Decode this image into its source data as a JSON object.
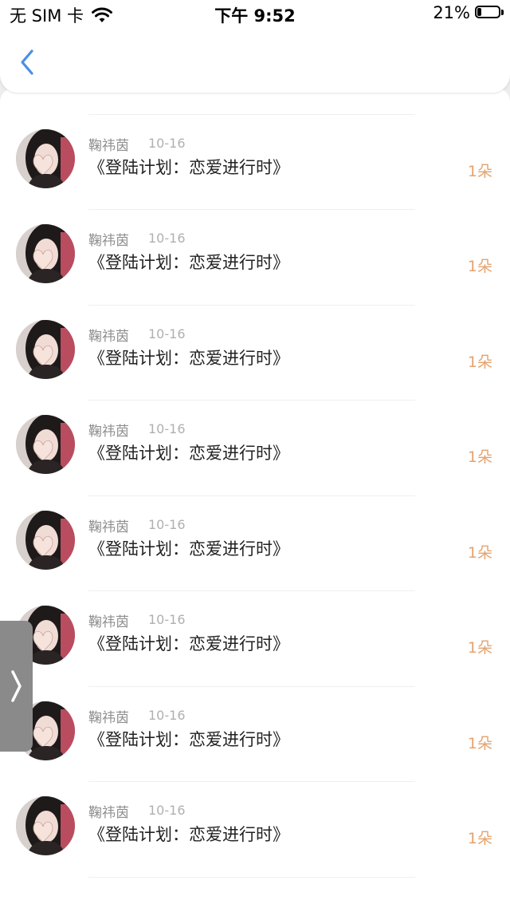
{
  "status_bar": {
    "carrier": "无 SIM 卡",
    "time": "下午 9:52",
    "battery": "21%",
    "battery_level": 0.21
  },
  "nav": {
    "back_icon": "chevron-left-icon"
  },
  "items": [
    {
      "name": "",
      "date": "",
      "title": "《登陆计划：恋爱进行时》",
      "count": "1朵"
    },
    {
      "name": "鞠祎茵",
      "date": "10-16",
      "title": "《登陆计划：恋爱进行时》",
      "count": "1朵"
    },
    {
      "name": "鞠祎茵",
      "date": "10-16",
      "title": "《登陆计划：恋爱进行时》",
      "count": "1朵"
    },
    {
      "name": "鞠祎茵",
      "date": "10-16",
      "title": "《登陆计划：恋爱进行时》",
      "count": "1朵"
    },
    {
      "name": "鞠祎茵",
      "date": "10-16",
      "title": "《登陆计划：恋爱进行时》",
      "count": "1朵"
    },
    {
      "name": "鞠祎茵",
      "date": "10-16",
      "title": "《登陆计划：恋爱进行时》",
      "count": "1朵"
    },
    {
      "name": "鞠祎茵",
      "date": "10-16",
      "title": "《登陆计划：恋爱进行时》",
      "count": "1朵"
    },
    {
      "name": "鞠祎茵",
      "date": "10-16",
      "title": "《登陆计划：恋爱进行时》",
      "count": "1朵"
    },
    {
      "name": "鞠祎茵",
      "date": "10-16",
      "title": "《登陆计划：恋爱进行时》",
      "count": "1朵"
    }
  ],
  "side_handle": {
    "icon": "chevron-right-icon"
  },
  "colors": {
    "accent": "#4a90e2",
    "count": "#e4a36f"
  }
}
